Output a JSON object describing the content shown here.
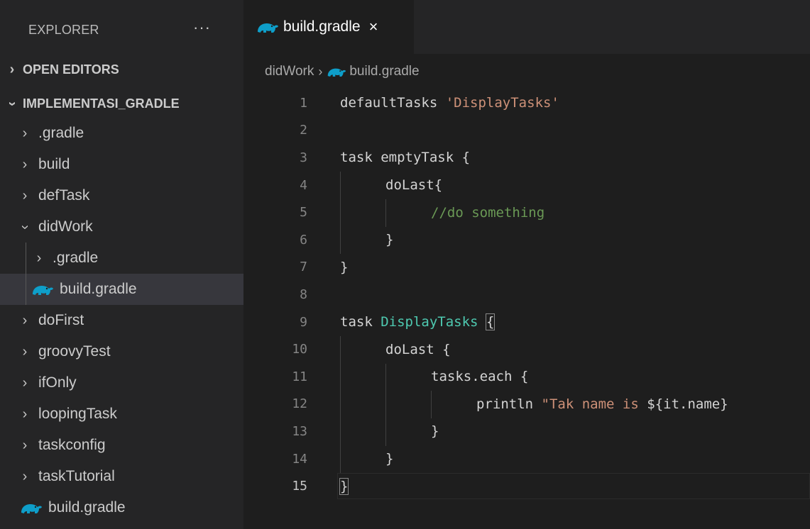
{
  "explorer": {
    "title": "EXPLORER",
    "more": "···",
    "open_editors": "OPEN EDITORS",
    "project": "IMPLEMENTASI_GRADLE",
    "tree": [
      {
        "label": ".gradle",
        "type": "folder",
        "expanded": false
      },
      {
        "label": "build",
        "type": "folder",
        "expanded": false
      },
      {
        "label": "defTask",
        "type": "folder",
        "expanded": false
      },
      {
        "label": "didWork",
        "type": "folder",
        "expanded": true
      },
      {
        "label": ".gradle",
        "type": "folder",
        "expanded": false
      },
      {
        "label": "build.gradle",
        "type": "file",
        "selected": true
      },
      {
        "label": "doFirst",
        "type": "folder",
        "expanded": false
      },
      {
        "label": "groovyTest",
        "type": "folder",
        "expanded": false
      },
      {
        "label": "ifOnly",
        "type": "folder",
        "expanded": false
      },
      {
        "label": "loopingTask",
        "type": "folder",
        "expanded": false
      },
      {
        "label": "taskconfig",
        "type": "folder",
        "expanded": false
      },
      {
        "label": "taskTutorial",
        "type": "folder",
        "expanded": false
      },
      {
        "label": "build.gradle",
        "type": "file",
        "selected": false
      }
    ]
  },
  "tab": {
    "label": "build.gradle",
    "close": "×"
  },
  "breadcrumb": {
    "folder": "didWork",
    "file": "build.gradle"
  },
  "code": {
    "line_numbers": [
      "1",
      "2",
      "3",
      "4",
      "5",
      "6",
      "7",
      "8",
      "9",
      "10",
      "11",
      "12",
      "13",
      "14",
      "15"
    ],
    "l1_kw": "defaultTasks",
    "l1_str": "'DisplayTasks'",
    "l3_kw": "task",
    "l3_name": "emptyTask",
    "l3_brace": "{",
    "l4_fn": "doLast{",
    "l5_cmt": "//do something",
    "l6_brace": "}",
    "l7_brace": "}",
    "l9_kw": "task",
    "l9_name": "DisplayTasks",
    "l9_brace": "{",
    "l10_fn": "doLast {",
    "l11_fn": "tasks.each {",
    "l12_fn": "println",
    "l12_str": "\"Tak name is ",
    "l12_interp": "${it.name}",
    "l13_brace": "}",
    "l14_brace": "}",
    "l15_brace": "}"
  },
  "colors": {
    "sidebar_bg": "#252526",
    "editor_bg": "#1e1e1e",
    "selected_row": "#37373d",
    "string": "#ce9178",
    "type_identifier": "#4ec9b0",
    "comment": "#6a9955",
    "gradle_icon": "#0e9ec9"
  }
}
